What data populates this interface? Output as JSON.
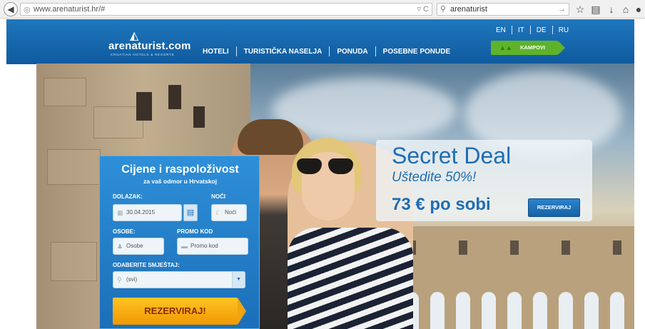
{
  "browser": {
    "url": "www.arenaturist.hr/#",
    "url_controls": "▿ C",
    "search_query": "arenaturist"
  },
  "icons": [
    "back-arrow-icon",
    "globe-icon",
    "search-icon",
    "star-icon",
    "bookmarks-icon",
    "download-icon",
    "home-icon",
    "menu-icon",
    "camp-tent-icon",
    "calendar-icon",
    "moon-icon",
    "person-icon",
    "tag-icon",
    "location-pin-icon",
    "chevron-down-icon"
  ],
  "colors": {
    "header_blue": "#1f77bd",
    "kampovi_green": "#5eb32a",
    "booking_blue": "#2e8fd8",
    "cta_orange": "#f7b316",
    "promo_text_blue": "#1f6db3"
  },
  "site": {
    "logo": "arenaturist.com",
    "logo_tagline": "CROATIAN HOTELS & RESORTS",
    "nav": [
      "HOTELI",
      "TURISTIČKA NASELJA",
      "PONUDA",
      "POSEBNE PONUDE"
    ],
    "languages": [
      "EN",
      "IT",
      "DE",
      "RU"
    ],
    "kampovi_label": "KAMPOVI"
  },
  "booking": {
    "title": "Cijene i raspoloživost",
    "subtitle": "za vaš odmor u Hrvatskoj",
    "arrival_label": "DOLAZAK:",
    "arrival_value": "30.04.2015",
    "nights_label": "NOĆI",
    "nights_placeholder": "Noći",
    "persons_label": "OSOBE:",
    "persons_placeholder": "Osobe",
    "promo_label": "PROMO KOD",
    "promo_placeholder": "Promo kod",
    "accommodation_label": "ODABERITE SMJEŠTAJ:",
    "accommodation_value": "(svi)",
    "submit_label": "REZERVIRAJ!"
  },
  "promo": {
    "title": "Secret Deal",
    "subtitle": "Uštedite 50%!",
    "price": "73 €   po sobi",
    "button_label": "REZERVIRAJ"
  }
}
